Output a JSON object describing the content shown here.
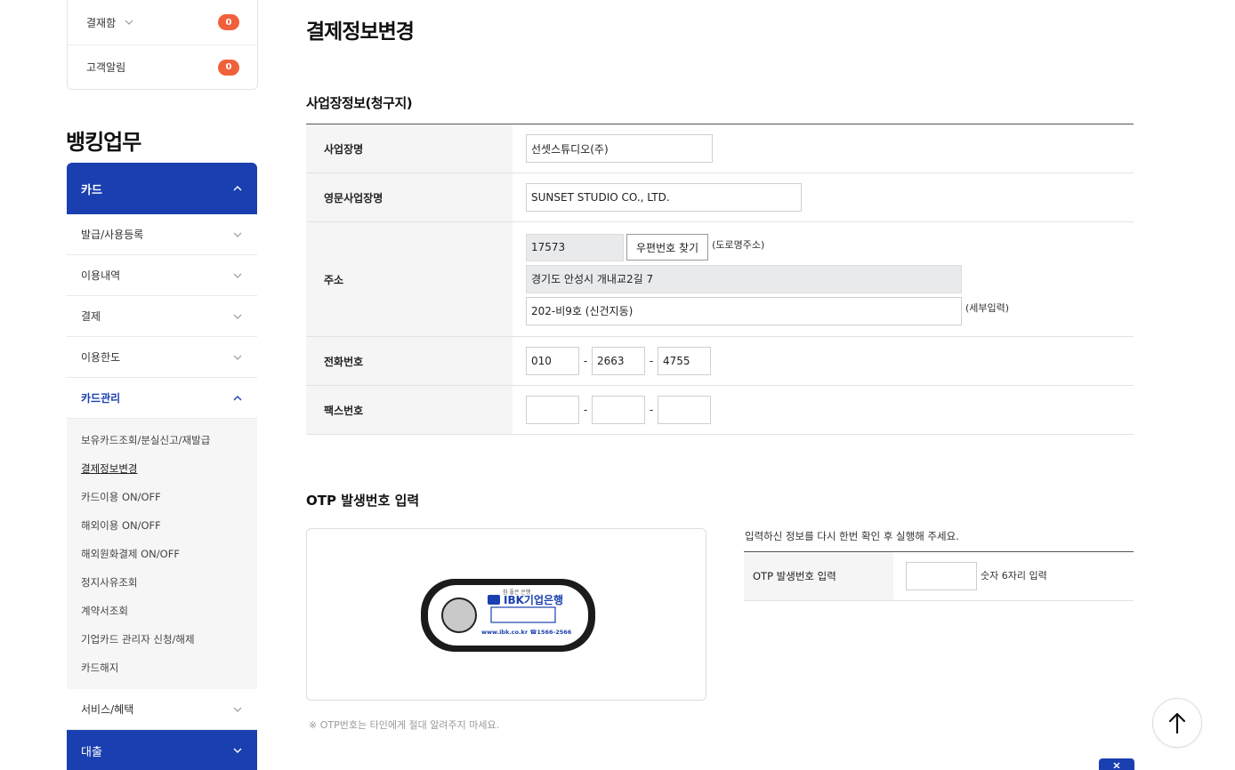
{
  "sidebar": {
    "notifications": [
      {
        "label": "결재함",
        "count": "0"
      },
      {
        "label": "고객알림",
        "count": "0"
      }
    ],
    "section_title": "뱅킹업무",
    "menu_top": "카드",
    "menu_items": [
      "발급/사용등록",
      "이용내역",
      "결제",
      "이용한도"
    ],
    "active_group": "카드관리",
    "submenu": [
      "보유카드조회/분실신고/재발급",
      "결제정보변경",
      "카드이용 ON/OFF",
      "해외이용 ON/OFF",
      "해외원화결제 ON/OFF",
      "정지사유조회",
      "계약서조회",
      "기업카드 관리자 신청/해제",
      "카드해지"
    ],
    "after_item": "서비스/혜택",
    "menu_bottom": "대출"
  },
  "main": {
    "page_title": "결제정보변경",
    "section_title": "사업장정보(청구지)",
    "rows": {
      "business_name_label": "사업장명",
      "business_name": "선셋스튜디오(주)",
      "english_name_label": "영문사업장명",
      "english_name": "SUNSET STUDIO CO., LTD.",
      "address_label": "주소",
      "postcode": "17573",
      "postcode_button": "우편번호 찾기",
      "road_hint": "(도로명주소)",
      "address1": "경기도 안성시 개내교2길 7",
      "address2": "202-비9호 (신건지동)",
      "detail_hint": "(세부입력)",
      "phone_label": "전화번호",
      "phone1": "010",
      "phone2": "2663",
      "phone3": "4755",
      "fax_label": "팩스번호",
      "fax1": "",
      "fax2": "",
      "fax3": "",
      "dash": "-"
    },
    "otp": {
      "title": "OTP 발생번호 입력",
      "guide": "입력하신 정보를 다시 한번 확인 후 실행해 주세요.",
      "label": "OTP 발생번호 입력",
      "value": "",
      "hint": "숫자 6자리 입력",
      "note": "※ OTP번호는 타인에게 절대 알려주지 마세요.",
      "device_brand": "IBK기업은행",
      "device_slogan": "참 좋은 은행",
      "device_url": "www.ibk.co.kr ☎1566-2566"
    }
  },
  "colors": {
    "primary": "#1a3fb0",
    "badge": "#f0603a"
  }
}
